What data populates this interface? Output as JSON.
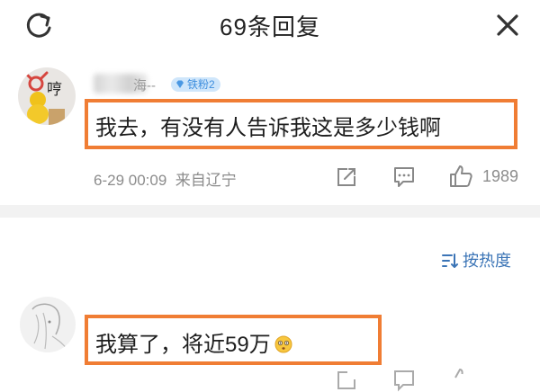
{
  "header": {
    "title": "69条回复"
  },
  "comments": [
    {
      "avatar_text": "哼",
      "username_tail": "海--",
      "fan_badge": "铁粉2",
      "text": "我去，有没有人告诉我这是多少钱啊",
      "date": "6-29 00:09",
      "location": "来自辽宁",
      "likes": "1989"
    },
    {
      "text": "我算了，将近59万"
    }
  ],
  "sort": {
    "label": "按热度"
  },
  "colors": {
    "highlight": "#f07d34",
    "link": "#3b74b6",
    "badge_bg": "#cfe6fb"
  }
}
